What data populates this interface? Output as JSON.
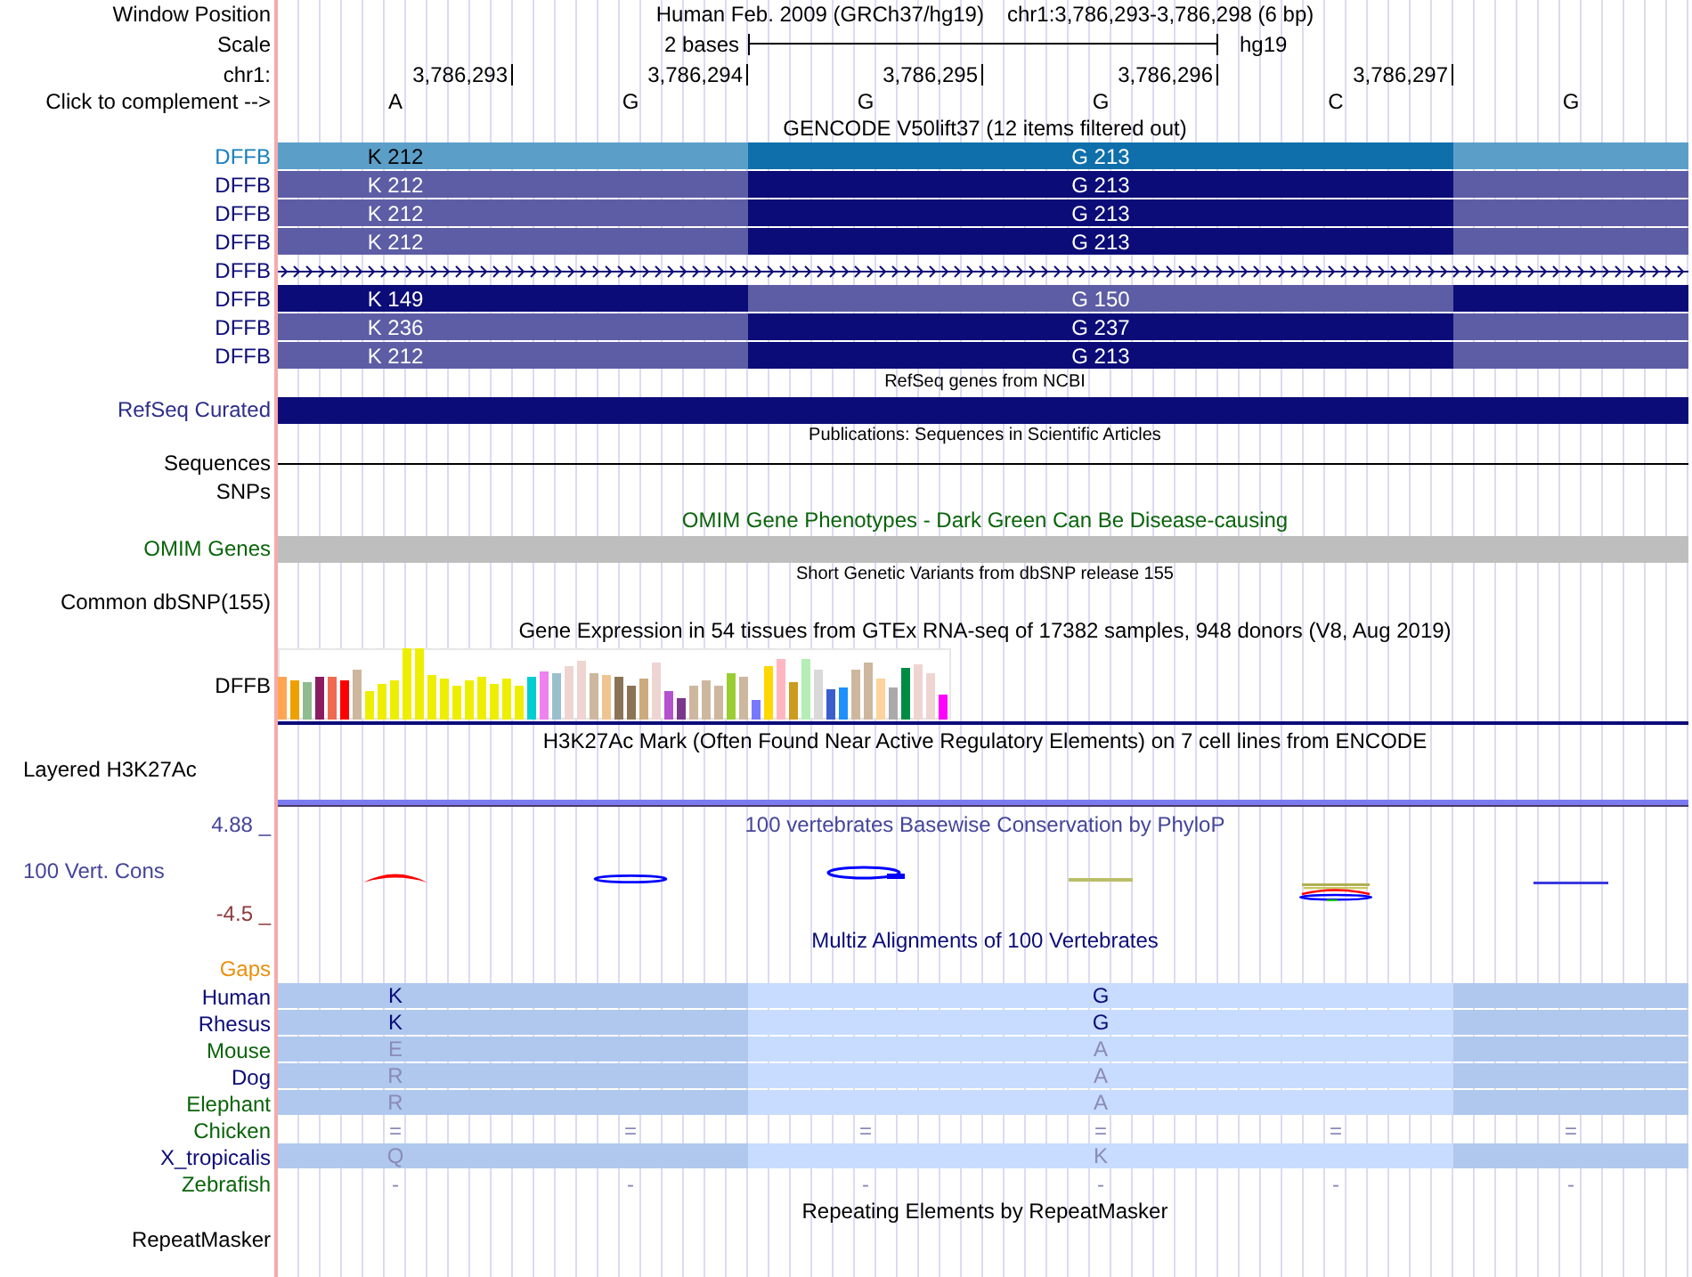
{
  "position": {
    "label": "Window Position",
    "assembly": "Human Feb. 2009 (GRCh37/hg19)",
    "range": "chr1:3,786,293-3,786,298 (6 bp)"
  },
  "scale": {
    "label": "Scale",
    "length": "2 bases",
    "assembly": "hg19"
  },
  "ruler": {
    "label": "chr1:",
    "ticks": [
      "3,786,293",
      "3,786,294",
      "3,786,295",
      "3,786,296",
      "3,786,297"
    ]
  },
  "sequence": {
    "label": "Click to complement -->",
    "bases": [
      "A",
      "G",
      "G",
      "G",
      "C",
      "G"
    ]
  },
  "tracks": [
    {
      "kind": "track",
      "title": "GENCODE V50lift37 (12 items filtered out)",
      "color": "#000000",
      "condensed": false,
      "rows": [
        {
          "kind": "codons",
          "label": "DFFB",
          "color": "#1a7fbf",
          "segments": [
            {
              "color": "#5b9fc9",
              "label": "K 212"
            },
            {
              "color": "#0f6fab",
              "label": "G 213"
            },
            {
              "color": "#5b9fc9"
            }
          ]
        },
        {
          "kind": "codons",
          "label": "DFFB",
          "color": "#0c0c78",
          "segments": [
            {
              "color": "#5d5da5",
              "label": "K 212"
            },
            {
              "color": "#0c0c78",
              "label": "G 213"
            },
            {
              "color": "#5d5da5"
            }
          ]
        },
        {
          "kind": "codons",
          "label": "DFFB",
          "color": "#0c0c78",
          "segments": [
            {
              "color": "#5d5da5",
              "label": "K 212"
            },
            {
              "color": "#0c0c78",
              "label": "G 213"
            },
            {
              "color": "#5d5da5"
            }
          ]
        },
        {
          "kind": "codons",
          "label": "DFFB",
          "color": "#0c0c78",
          "segments": [
            {
              "color": "#5d5da5",
              "label": "K 212"
            },
            {
              "color": "#0c0c78",
              "label": "G 213"
            },
            {
              "color": "#5d5da5"
            }
          ]
        },
        {
          "kind": "intron",
          "label": "DFFB",
          "color": "#0c0c78"
        },
        {
          "kind": "codons",
          "label": "DFFB",
          "color": "#0c0c78",
          "segments": [
            {
              "color": "#0c0c78",
              "label": "K 149"
            },
            {
              "color": "#5d5da5",
              "label": "G 150"
            },
            {
              "color": "#0c0c78"
            }
          ]
        },
        {
          "kind": "codons",
          "label": "DFFB",
          "color": "#0c0c78",
          "segments": [
            {
              "color": "#5d5da5",
              "label": "K 236"
            },
            {
              "color": "#0c0c78",
              "label": "G 237"
            },
            {
              "color": "#5d5da5"
            }
          ]
        },
        {
          "kind": "codons",
          "label": "DFFB",
          "color": "#0c0c78",
          "segments": [
            {
              "color": "#5d5da5",
              "label": "K 212"
            },
            {
              "color": "#0c0c78",
              "label": "G 213"
            },
            {
              "color": "#5d5da5"
            }
          ]
        }
      ]
    },
    {
      "kind": "track",
      "title": "RefSeq genes from NCBI",
      "color": "#000000",
      "condensed": true,
      "rows": [
        {
          "kind": "bar",
          "label": "RefSeq Curated",
          "color": "#2d2d8c",
          "segments": [
            {
              "color": "#0c0c78"
            }
          ]
        }
      ]
    },
    {
      "kind": "track",
      "title": "Publications: Sequences in Scientific Articles",
      "color": "#000000",
      "condensed": true,
      "rows": [
        {
          "kind": "line",
          "label": "Sequences",
          "color": "#000000"
        },
        {
          "kind": "empty",
          "label": "SNPs",
          "color": "#000000"
        }
      ]
    },
    {
      "kind": "track",
      "title": "OMIM Gene Phenotypes - Dark Green Can Be Disease-causing",
      "color": "#0a640a",
      "condensed": false,
      "rows": [
        {
          "kind": "bar",
          "label": "OMIM Genes",
          "color": "#0a640a",
          "segments": [
            {
              "color": "#bebebe"
            }
          ]
        }
      ]
    },
    {
      "kind": "track",
      "title": "Short Genetic Variants from dbSNP release 155",
      "color": "#000000",
      "condensed": true,
      "rows": [
        {
          "kind": "empty",
          "label": "Common dbSNP(155)",
          "color": "#000000"
        }
      ]
    },
    {
      "kind": "track",
      "title": "Gene Expression in 54 tissues from GTEx RNA-seq of 17382 samples, 948 donors (V8, Aug 2019)",
      "color": "#000000",
      "condensed": false,
      "rows": [
        {
          "kind": "expression",
          "label": "DFFB",
          "color": "#000000"
        }
      ]
    },
    {
      "kind": "track",
      "title": "H3K27Ac Mark (Often Found Near Active Regulatory Elements) on 7 cell lines from ENCODE",
      "color": "#000000",
      "condensed": false,
      "rows": [
        {
          "kind": "signal",
          "label": "Layered H3K27Ac",
          "color": "#000000"
        }
      ]
    },
    {
      "kind": "wiggle",
      "title": "100 vertebrates Basewise Conservation by PhyloP",
      "color": "#45459a",
      "condensed": false,
      "rows": [
        {
          "kind": "conservation",
          "label": "100 Vert. Cons",
          "color": "#45459a",
          "ymax": "4.88 _",
          "ymin": "-4.5 _"
        }
      ]
    },
    {
      "kind": "track",
      "title": "Multiz Alignments of 100 Vertebrates",
      "color": "#0c0c78",
      "condensed": false,
      "rows": [
        {
          "kind": "empty",
          "label": "Gaps",
          "color": "#e8900e"
        },
        {
          "kind": "alignment",
          "label": "Human",
          "color": "#0c0c78",
          "dimmed": false,
          "segments": [
            {
              "color": "#b0c8ee",
              "label": "K"
            },
            {
              "color": "#c8dcff",
              "label": "G"
            },
            {
              "color": "#b0c8ee"
            }
          ]
        },
        {
          "kind": "alignment",
          "label": "Rhesus",
          "color": "#0c0c78",
          "dimmed": false,
          "segments": [
            {
              "color": "#b0c8ee",
              "label": "K"
            },
            {
              "color": "#c8dcff",
              "label": "G"
            },
            {
              "color": "#b0c8ee"
            }
          ]
        },
        {
          "kind": "alignment",
          "label": "Mouse",
          "color": "#0a640a",
          "dimmed": true,
          "segments": [
            {
              "color": "#b0c8ee",
              "label": "E"
            },
            {
              "color": "#c8dcff",
              "label": "A"
            },
            {
              "color": "#b0c8ee"
            }
          ]
        },
        {
          "kind": "alignment",
          "label": "Dog",
          "color": "#0c0c78",
          "dimmed": true,
          "segments": [
            {
              "color": "#b0c8ee",
              "label": "R"
            },
            {
              "color": "#c8dcff",
              "label": "A"
            },
            {
              "color": "#b0c8ee"
            }
          ]
        },
        {
          "kind": "alignment",
          "label": "Elephant",
          "color": "#0a640a",
          "dimmed": true,
          "segments": [
            {
              "color": "#b0c8ee",
              "label": "R"
            },
            {
              "color": "#c8dcff",
              "label": "A"
            },
            {
              "color": "#b0c8ee"
            }
          ]
        },
        {
          "kind": "marks",
          "label": "Chicken",
          "color": "#0a640a",
          "marks": [
            "=",
            "=",
            "=",
            "=",
            "=",
            "="
          ]
        },
        {
          "kind": "alignment",
          "label": "X_tropicalis",
          "color": "#0c0c78",
          "dimmed": true,
          "segments": [
            {
              "color": "#b0c8ee",
              "label": "Q"
            },
            {
              "color": "#c8dcff",
              "label": "K"
            },
            {
              "color": "#b0c8ee"
            }
          ]
        },
        {
          "kind": "marks",
          "label": "Zebrafish",
          "color": "#0a640a",
          "marks": [
            "-",
            "-",
            "-",
            "-",
            "-",
            "-"
          ]
        }
      ]
    },
    {
      "kind": "track",
      "title": "Repeating Elements by RepeatMasker",
      "color": "#000000",
      "condensed": false,
      "rows": [
        {
          "kind": "empty",
          "label": "RepeatMasker",
          "color": "#000000"
        }
      ]
    }
  ]
}
